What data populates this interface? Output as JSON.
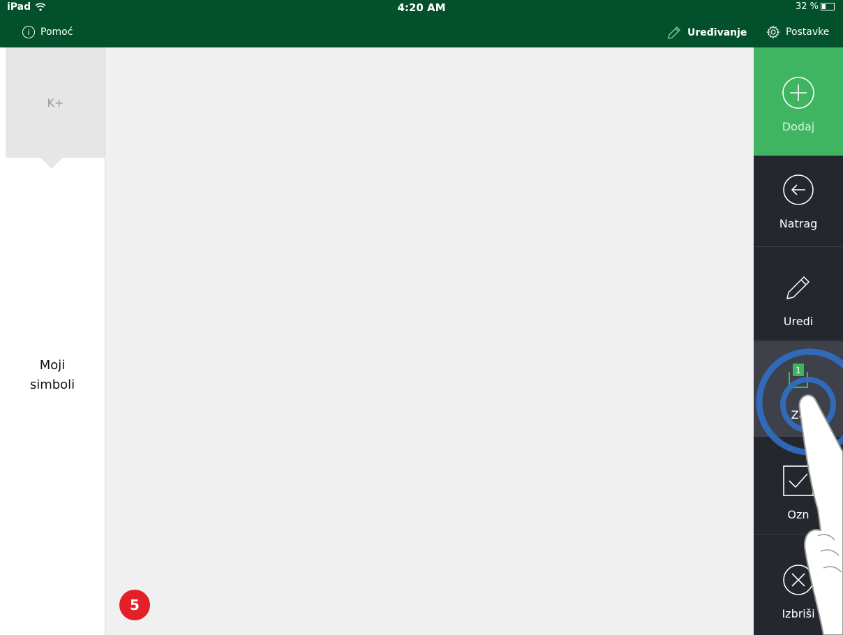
{
  "status_bar": {
    "carrier": "iPad",
    "time": "4:20 AM",
    "battery": "32 %"
  },
  "header": {
    "help_label": "Pomoć",
    "edit_label": "Uređivanje",
    "settings_label": "Postavke"
  },
  "sidebar": {
    "tab_label": "K+",
    "group_line1": "Moji",
    "group_line2": "simboli"
  },
  "canvas": {
    "step_number": "5"
  },
  "toolbar": {
    "add_label": "Dodaj",
    "back_label": "Natrag",
    "edit_label": "Uredi",
    "lock_badge": "1",
    "lock_label": "Za",
    "mark_label": "Ozn",
    "delete_label": "Izbriši"
  },
  "colors": {
    "header_bg": "#02502c",
    "add_button_bg": "#3fb561",
    "toolbar_bg": "#24272d",
    "step_badge": "#e32028",
    "tap_ring": "#2f6fc4"
  }
}
